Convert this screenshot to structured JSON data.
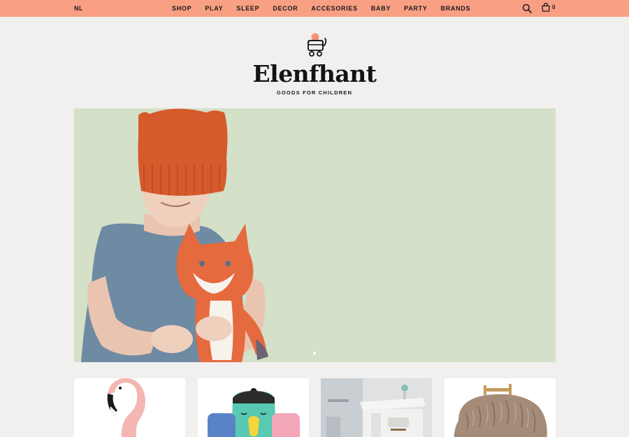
{
  "header": {
    "language": "NL",
    "nav": [
      {
        "label": "SHOP"
      },
      {
        "label": "PLAY"
      },
      {
        "label": "SLEEP"
      },
      {
        "label": "DECOR"
      },
      {
        "label": "ACCESORIES"
      },
      {
        "label": "BABY"
      },
      {
        "label": "PARTY"
      },
      {
        "label": "BRANDS"
      }
    ],
    "cart_count": "0",
    "search_icon": "search-icon",
    "cart_icon": "shopping-bag-icon"
  },
  "logo": {
    "name": "Elenfhant",
    "tagline": "GOODS FOR CHILDREN",
    "icon": "elephant-icon"
  },
  "colors": {
    "topbar": "#f99f83",
    "page_background": "#f1f0ee",
    "hero_background": "#d4e0c7",
    "accent": "#f4917a"
  },
  "hero": {
    "slide_count": 1,
    "active_slide": 1
  },
  "products": [
    {
      "name": "flamingo-plush"
    },
    {
      "name": "elephant-plush"
    },
    {
      "name": "toy-espresso-machine"
    },
    {
      "name": "furry-ride-on"
    }
  ]
}
